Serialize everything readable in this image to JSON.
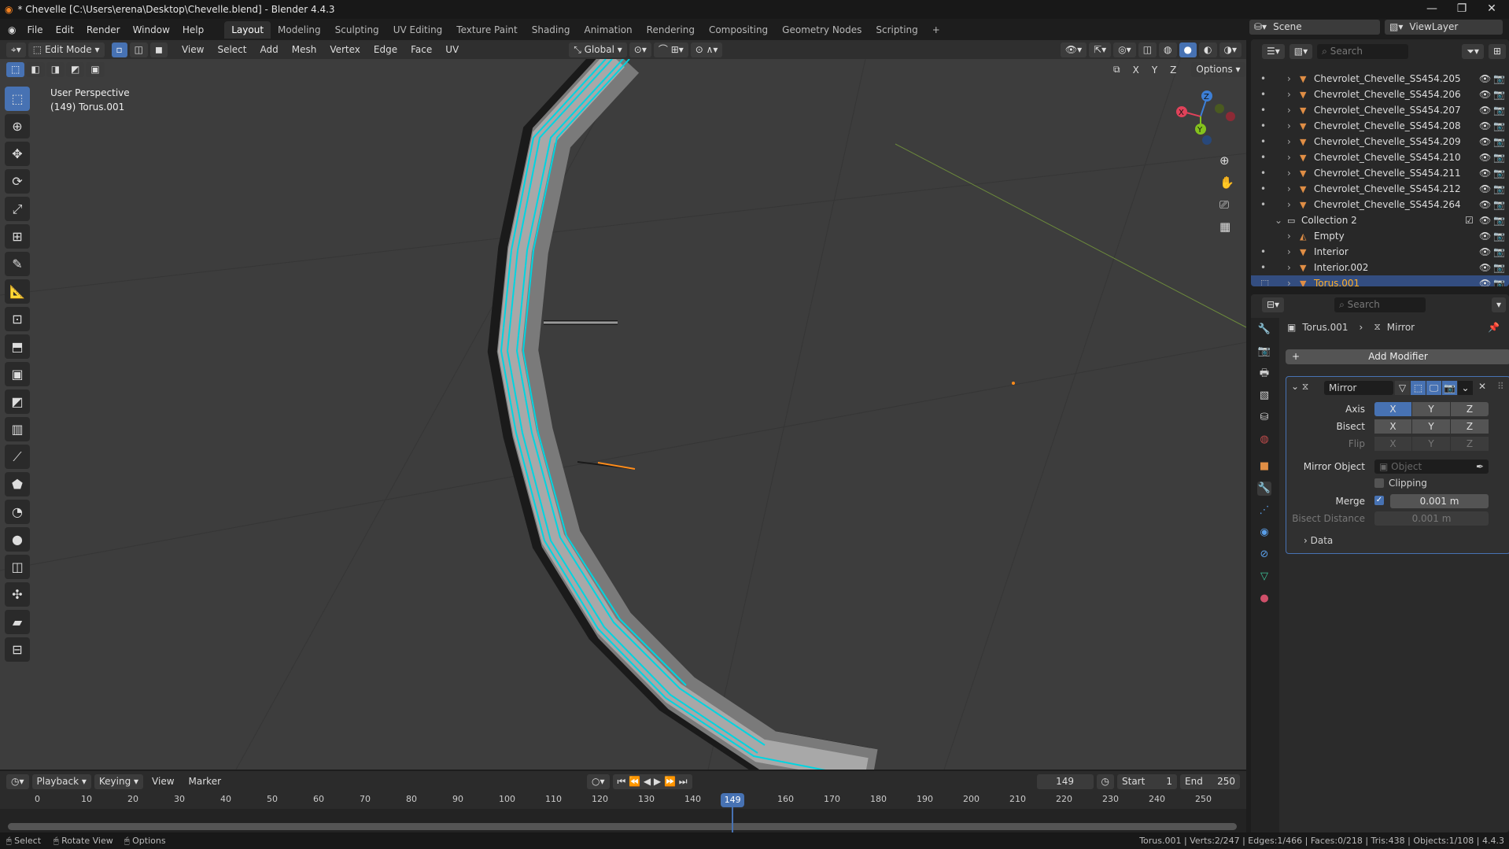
{
  "window": {
    "title": "* Chevelle [C:\\Users\\erena\\Desktop\\Chevelle.blend] - Blender 4.4.3",
    "minimize": "—",
    "maximize": "❐",
    "close": "✕"
  },
  "menu": [
    "File",
    "Edit",
    "Render",
    "Window",
    "Help"
  ],
  "workspaces": [
    "Layout",
    "Modeling",
    "Sculpting",
    "UV Editing",
    "Texture Paint",
    "Shading",
    "Animation",
    "Rendering",
    "Compositing",
    "Geometry Nodes",
    "Scripting",
    "+"
  ],
  "active_workspace": "Layout",
  "viewport_header": {
    "mode": "Edit Mode",
    "menus": [
      "View",
      "Select",
      "Add",
      "Mesh",
      "Vertex",
      "Edge",
      "Face",
      "UV"
    ],
    "orientation": "Global",
    "options": "Options",
    "axes": [
      "X",
      "Y",
      "Z"
    ]
  },
  "viewport": {
    "perspective": "User Perspective",
    "object": "(149) Torus.001",
    "gizmo": {
      "x": "X",
      "y": "Y",
      "z": "Z"
    }
  },
  "tools": [
    "select-box",
    "cursor",
    "move",
    "rotate",
    "scale",
    "transform",
    "annotate",
    "measure",
    "add-cube",
    "extrude",
    "inset",
    "bevel",
    "loop-cut",
    "knife",
    "poly-build",
    "spin",
    "smooth",
    "edge-slide",
    "shrink-fatten",
    "shear",
    "rip"
  ],
  "timeline": {
    "menus": [
      "Playback",
      "Keying",
      "View",
      "Marker"
    ],
    "current_frame": "149",
    "start_label": "Start",
    "start": "1",
    "end_label": "End",
    "end": "250",
    "ticks": [
      "0",
      "10",
      "20",
      "30",
      "40",
      "50",
      "60",
      "70",
      "80",
      "90",
      "100",
      "110",
      "120",
      "130",
      "140",
      "160",
      "170",
      "180",
      "190",
      "200",
      "210",
      "220",
      "230",
      "240",
      "250"
    ],
    "playhead": 149,
    "playhead_label": "149"
  },
  "status": {
    "left": [
      "Select",
      "Rotate View",
      "Options"
    ],
    "right": "Torus.001 | Verts:2/247 | Edges:1/466 | Faces:0/218 | Tris:438 | Objects:1/108 | 4.4.3"
  },
  "scene_selector": {
    "scene": "Scene",
    "view_layer": "ViewLayer"
  },
  "outliner": {
    "search_placeholder": "Search",
    "items": [
      {
        "name": "Chevrolet_Chevelle_SS454.205",
        "type": "mesh",
        "indent": 1
      },
      {
        "name": "Chevrolet_Chevelle_SS454.206",
        "type": "mesh",
        "indent": 1
      },
      {
        "name": "Chevrolet_Chevelle_SS454.207",
        "type": "mesh",
        "indent": 1
      },
      {
        "name": "Chevrolet_Chevelle_SS454.208",
        "type": "mesh",
        "indent": 1
      },
      {
        "name": "Chevrolet_Chevelle_SS454.209",
        "type": "mesh",
        "indent": 1
      },
      {
        "name": "Chevrolet_Chevelle_SS454.210",
        "type": "mesh",
        "indent": 1
      },
      {
        "name": "Chevrolet_Chevelle_SS454.211",
        "type": "mesh",
        "indent": 1
      },
      {
        "name": "Chevrolet_Chevelle_SS454.212",
        "type": "mesh",
        "indent": 1
      },
      {
        "name": "Chevrolet_Chevelle_SS454.264",
        "type": "mesh",
        "indent": 1
      },
      {
        "name": "Collection 2",
        "type": "collection",
        "indent": 0
      },
      {
        "name": "Empty",
        "type": "empty",
        "indent": 1
      },
      {
        "name": "Interior",
        "type": "mesh",
        "indent": 1
      },
      {
        "name": "Interior.002",
        "type": "mesh",
        "indent": 1
      },
      {
        "name": "Torus.001",
        "type": "mesh",
        "indent": 1,
        "selected": true
      }
    ]
  },
  "properties": {
    "search_placeholder": "Search",
    "breadcrumb_object": "Torus.001",
    "breadcrumb_modifier": "Mirror",
    "add_modifier": "Add Modifier",
    "modifier": {
      "name": "Mirror",
      "axis_label": "Axis",
      "bisect_label": "Bisect",
      "flip_label": "Flip",
      "xyz": [
        "X",
        "Y",
        "Z"
      ],
      "axis_active": "X",
      "mirror_object_label": "Mirror Object",
      "mirror_object_placeholder": "Object",
      "clipping_label": "Clipping",
      "clipping": false,
      "merge_label": "Merge",
      "merge": true,
      "merge_value": "0.001 m",
      "bisect_distance_label": "Bisect Distance",
      "bisect_distance_value": "0.001 m",
      "data_label": "Data"
    }
  },
  "colors": {
    "accent": "#4772b3",
    "selected_text": "#ffaf29",
    "mesh_icon": "#e08e45",
    "edge_highlight": "#00d4e0"
  }
}
